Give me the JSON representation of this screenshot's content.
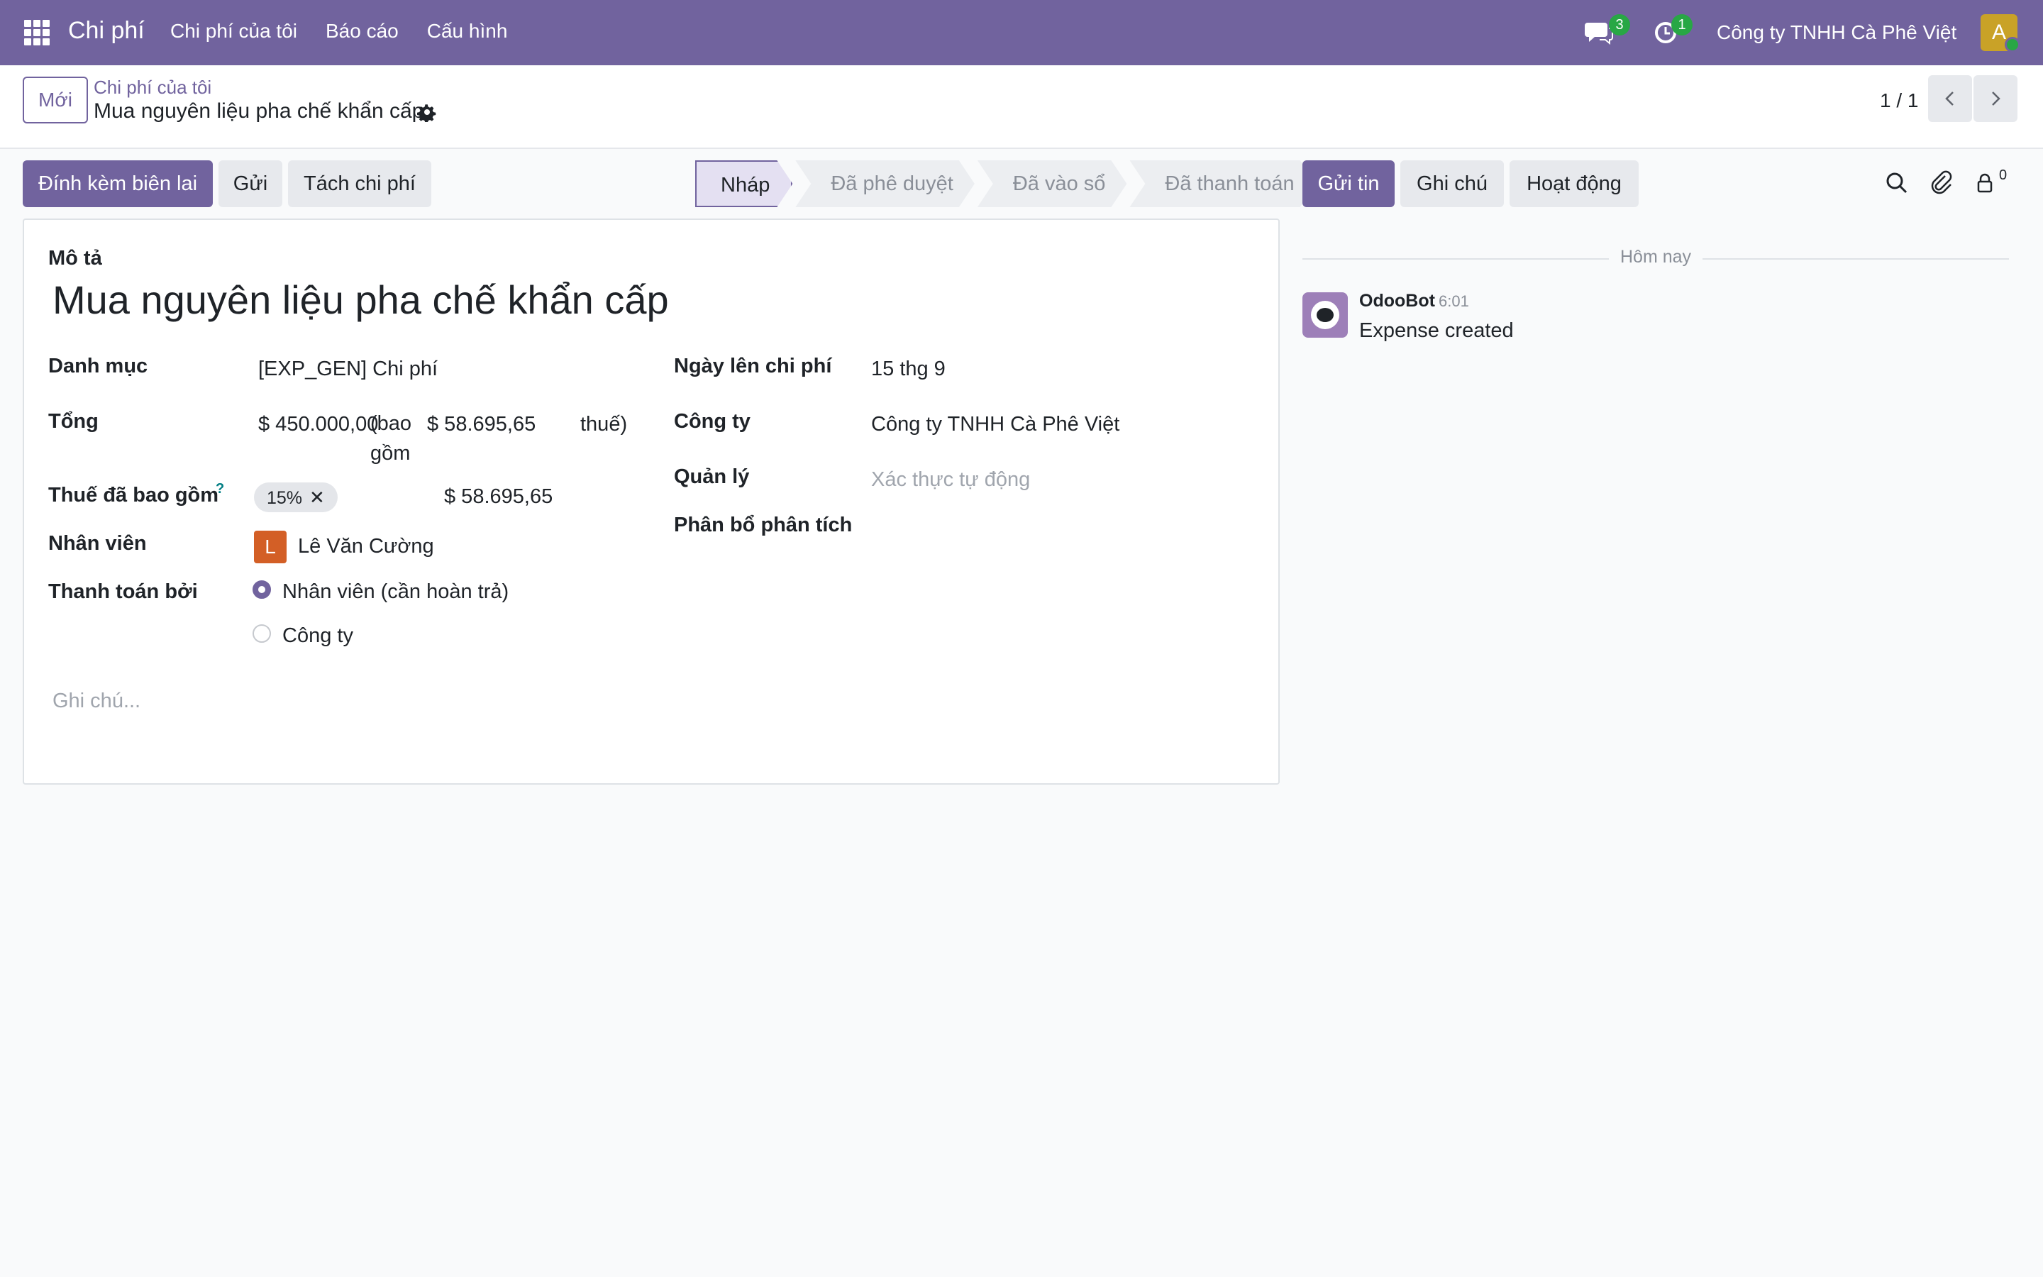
{
  "navbar": {
    "app_title": "Chi phí",
    "menu": [
      "Chi phí của tôi",
      "Báo cáo",
      "Cấu hình"
    ],
    "chat_badge": "3",
    "activity_badge": "1",
    "company": "Công ty TNHH Cà Phê Việt",
    "avatar_letter": "A"
  },
  "control": {
    "new_label": "Mới",
    "breadcrumb_parent": "Chi phí của tôi",
    "breadcrumb_current": "Mua nguyên liệu pha chế khẩn cấp",
    "pager": "1 / 1"
  },
  "actions": {
    "attach_receipt": "Đính kèm biên lai",
    "send": "Gửi",
    "split": "Tách chi phí"
  },
  "status": {
    "stages": [
      "Nháp",
      "Đã phê duyệt",
      "Đã vào sổ",
      "Đã thanh toán"
    ],
    "active_index": 0
  },
  "chatter_buttons": {
    "send_message": "Gửi tin",
    "log_note": "Ghi chú",
    "activity": "Hoạt động",
    "followers_count": "0"
  },
  "form": {
    "description_label": "Mô tả",
    "description": "Mua nguyên liệu pha chế khẩn cấp",
    "category_label": "Danh mục",
    "category": "[EXP_GEN] Chi phí",
    "total_label": "Tổng",
    "total_amount": "$ 450.000,00",
    "total_incl_open": "(bao gồm",
    "total_tax_amount": "$ 58.695,65",
    "total_incl_close": "thuế)",
    "tax_label": "Thuế đã bao gồm",
    "tax_help": "?",
    "tax_tag": "15%",
    "tax_amount": "$ 58.695,65",
    "employee_label": "Nhân viên",
    "employee_initial": "L",
    "employee": "Lê Văn Cường",
    "paid_by_label": "Thanh toán bởi",
    "paid_by_options": [
      "Nhân viên (cần hoàn trả)",
      "Công ty"
    ],
    "paid_by_selected": 0,
    "date_label": "Ngày lên chi phí",
    "date": "15 thg 9",
    "company_label": "Công ty",
    "company": "Công ty TNHH Cà Phê Việt",
    "manager_label": "Quản lý",
    "manager_placeholder": "Xác thực tự động",
    "analytic_label": "Phân bổ phân tích",
    "notes_placeholder": "Ghi chú..."
  },
  "chatter": {
    "date_separator": "Hôm nay",
    "messages": [
      {
        "author": "OdooBot",
        "time": "6:01",
        "body": "Expense created"
      }
    ]
  },
  "colors": {
    "brand": "#71639e",
    "badge": "#28a745",
    "employee_avatar": "#d35f26"
  }
}
